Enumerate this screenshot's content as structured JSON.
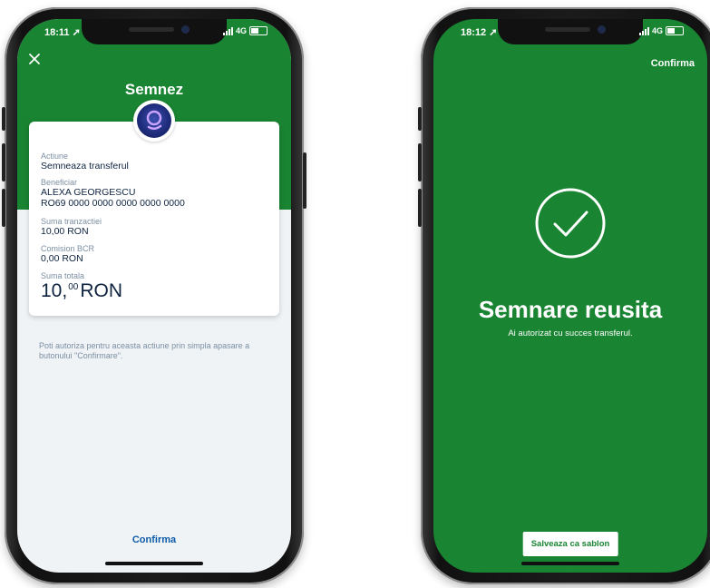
{
  "left_screen": {
    "status": {
      "time": "18:11",
      "network": "4G"
    },
    "title": "Semnez",
    "card": {
      "action_label": "Actiune",
      "action_value": "Semneaza transferul",
      "beneficiary_label": "Beneficiar",
      "beneficiary_name": "ALEXA GEORGESCU",
      "beneficiary_iban": "RO69 0000 0000 0000 0000 0000",
      "amount_label": "Suma tranzactiei",
      "amount_value": "10,00 RON",
      "fee_label": "Comision BCR",
      "fee_value": "0,00 RON",
      "total_label": "Suma totala",
      "total_int": "10,",
      "total_dec": "00",
      "total_currency": "RON"
    },
    "info_text": "Poti autoriza pentru aceasta actiune prin simpla apasare a butonului \"Confirmare\".",
    "confirm_button": "Confirma"
  },
  "right_screen": {
    "status": {
      "time": "18:12",
      "network": "4G"
    },
    "top_confirm": "Confirma",
    "success_title": "Semnare reusita",
    "success_subtitle": "Ai autorizat cu succes transferul.",
    "save_button": "Salveaza ca sablon"
  },
  "colors": {
    "brand_green": "#198432",
    "primary_text": "#0e2340",
    "link_blue": "#0c5ba8",
    "muted_text": "#7b8fa3"
  },
  "icons": [
    "close-icon",
    "assistant-avatar-icon",
    "checkmark-circle-icon",
    "signal-icon",
    "battery-icon",
    "location-arrow-icon"
  ]
}
